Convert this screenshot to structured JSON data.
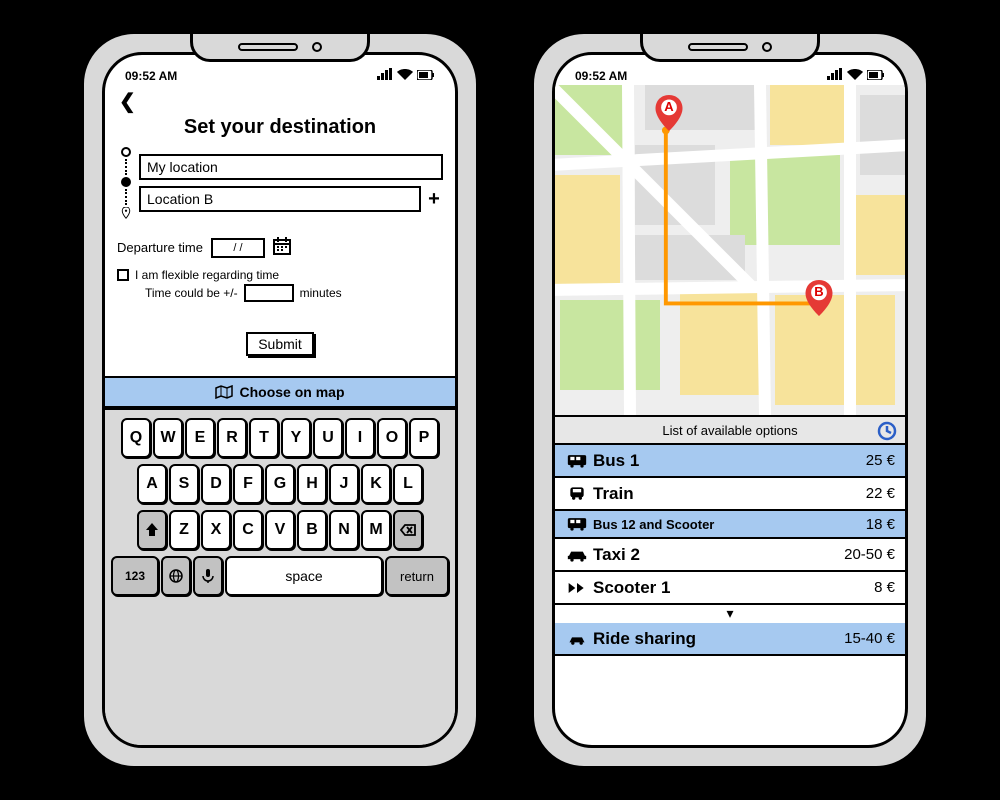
{
  "status": {
    "time": "09:52 AM"
  },
  "left": {
    "title": "Set your destination",
    "loc_a": "My location",
    "loc_b": "Location B",
    "dep_label": "Departure time",
    "dep_placeholder": "/ /",
    "flex_check": "I am flexible regarding time",
    "flex_detail_pre": "Time could be +/-",
    "flex_detail_post": "minutes",
    "submit": "Submit",
    "choose_map": "Choose on map"
  },
  "keyboard": {
    "r1": [
      "Q",
      "W",
      "E",
      "R",
      "T",
      "Y",
      "U",
      "I",
      "O",
      "P"
    ],
    "r2": [
      "A",
      "S",
      "D",
      "F",
      "G",
      "H",
      "J",
      "K",
      "L"
    ],
    "r3": [
      "Z",
      "X",
      "C",
      "V",
      "B",
      "N",
      "M"
    ],
    "num_key": "123",
    "space": "space",
    "return": "return"
  },
  "right": {
    "marker_a": "A",
    "marker_b": "B",
    "options_title": "List of available options",
    "currency": "€",
    "options": [
      {
        "type": "bus",
        "name": "Bus 1",
        "price": "25",
        "selected": true
      },
      {
        "type": "train",
        "name": "Train",
        "price": "22",
        "selected": false
      },
      {
        "type": "bus",
        "name": "Bus 12 and Scooter",
        "price": "18",
        "selected": true,
        "small": true
      },
      {
        "type": "taxi",
        "name": "Taxi 2",
        "price": "20-50",
        "selected": false
      },
      {
        "type": "scoot",
        "name": "Scooter 1",
        "price": "8",
        "selected": false
      },
      {
        "type": "share",
        "name": "Ride sharing",
        "price": "15-40",
        "selected": true
      }
    ]
  }
}
